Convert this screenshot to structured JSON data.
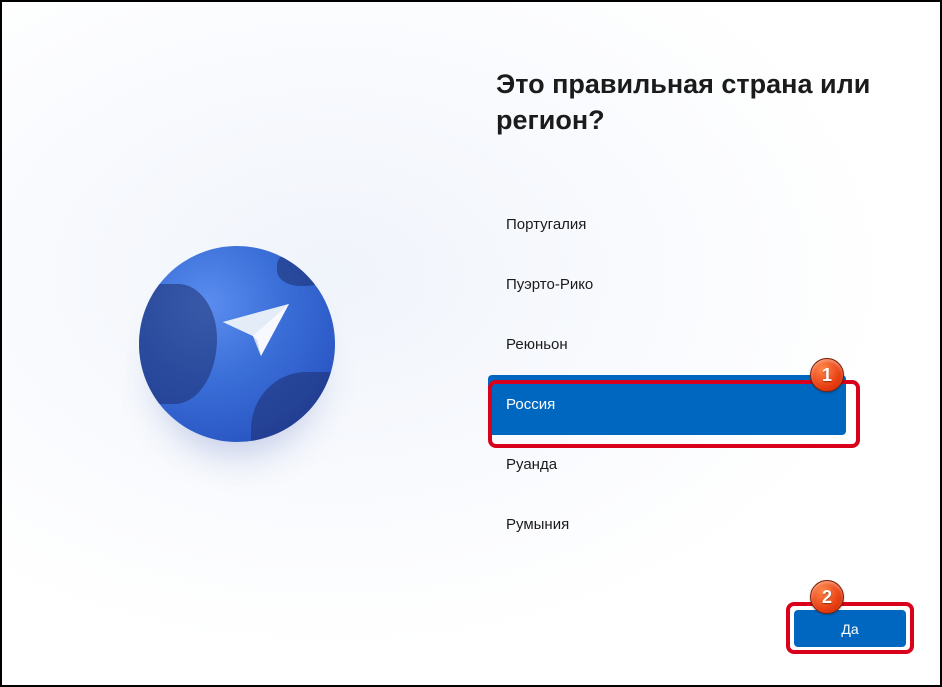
{
  "heading": "Это правильная страна или регион?",
  "countries": [
    "Португалия",
    "Пуэрто-Рико",
    "Реюньон",
    "Россия",
    "Руанда",
    "Румыния"
  ],
  "selected_index": 3,
  "yes_button": "Да",
  "badges": {
    "one": "1",
    "two": "2"
  }
}
